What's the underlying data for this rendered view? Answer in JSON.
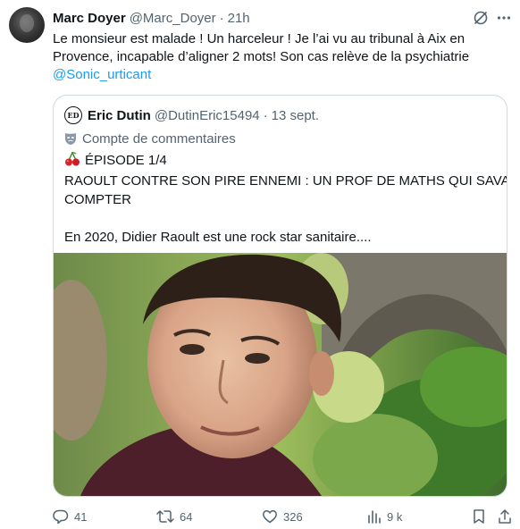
{
  "tweet": {
    "display_name": "Marc Doyer",
    "handle": "@Marc_Doyer",
    "separator": "·",
    "time": "21h",
    "lines": [
      "Le monsieur est malade ! Un harceleur ! Je l’ai vu au tribunal à Aix en",
      "Provence, incapable d’aligner 2 mots! Son cas relève de la psychiatrie"
    ],
    "mention": "@Sonic_urticant"
  },
  "quote": {
    "avatar_text": "ED",
    "display_name": "Eric Dutin",
    "handle": "@DutinEric15494",
    "separator": "·",
    "date": "13 sept.",
    "label": "Compte de commentaires",
    "episode": "ÉPISODE 1/4",
    "title_lines": [
      "RAOULT CONTRE SON PIRE ENNEMI : UN PROF DE MATHS QUI SAVAIT",
      "COMPTER"
    ],
    "teaser": "En 2020, Didier Raoult est une rock star sanitaire...."
  },
  "actions": {
    "replies": "41",
    "reposts": "64",
    "likes": "326",
    "views": "9 k"
  },
  "colors": {
    "accent": "#1d9bf0",
    "secondary_text": "#536471",
    "primary_text": "#0f1419",
    "border": "#cfd9de"
  },
  "icons": [
    "grok-icon",
    "more-icon",
    "mask-icon",
    "cherry-icon",
    "reply-icon",
    "repost-icon",
    "like-icon",
    "views-icon",
    "bookmark-icon",
    "share-icon"
  ]
}
